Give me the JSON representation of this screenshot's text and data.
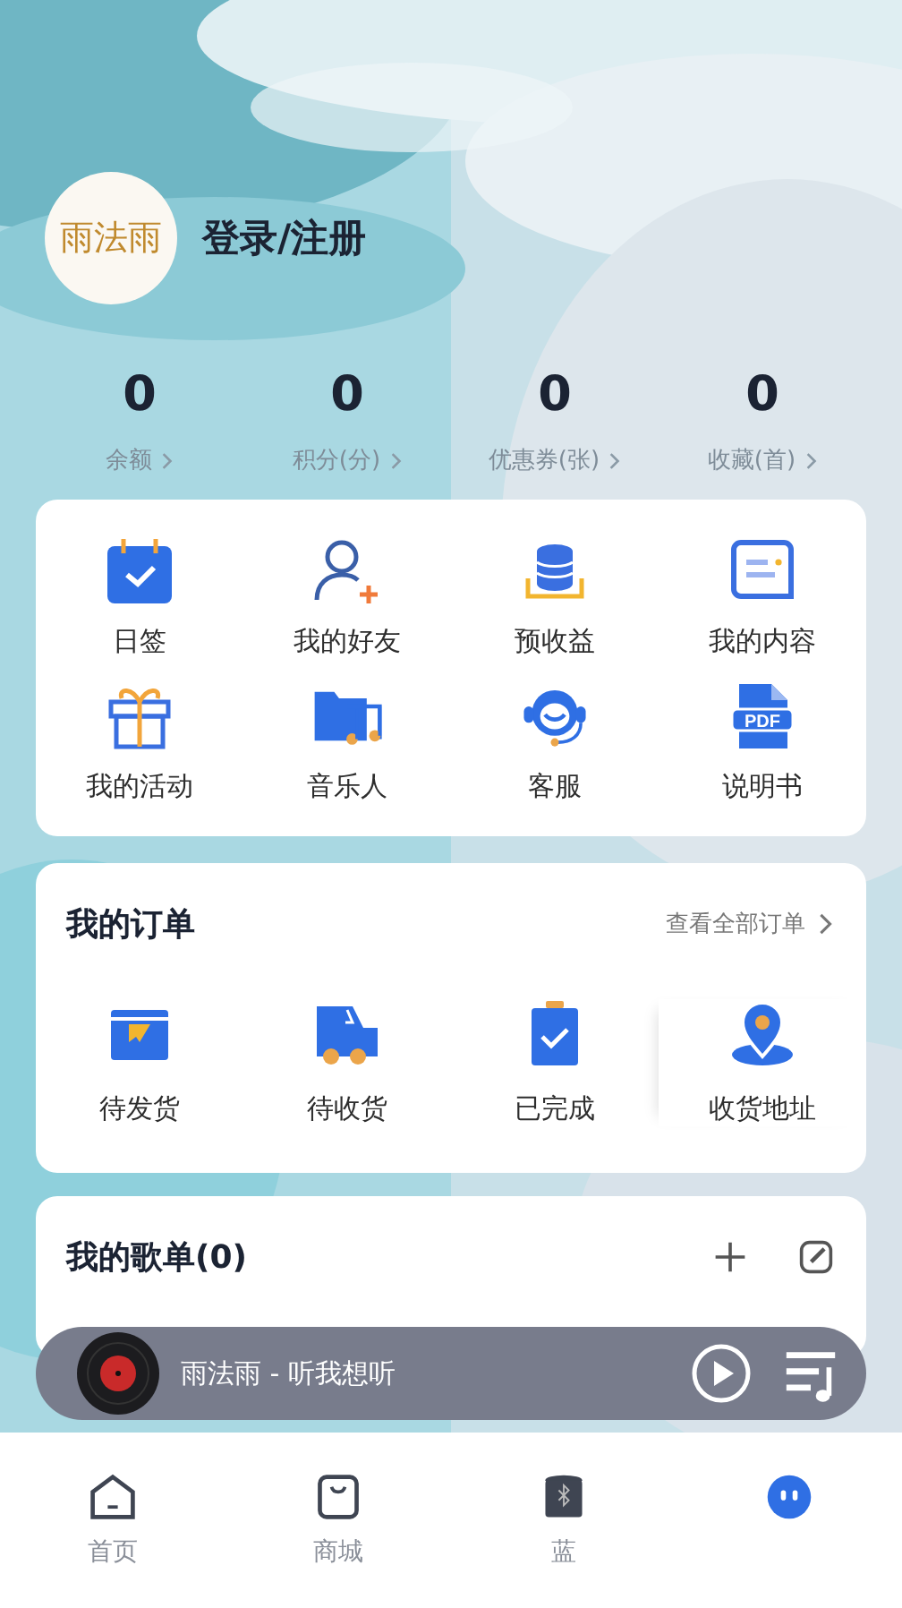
{
  "header": {
    "avatar_text": "雨法雨",
    "login": "登录/注册"
  },
  "stats": [
    {
      "value": "0",
      "label": "余额"
    },
    {
      "value": "0",
      "label": "积分(分)"
    },
    {
      "value": "0",
      "label": "优惠券(张)"
    },
    {
      "value": "0",
      "label": "收藏(首)"
    }
  ],
  "shortcuts": [
    {
      "label": "日签",
      "kind": "calendar"
    },
    {
      "label": "我的好友",
      "kind": "friend"
    },
    {
      "label": "预收益",
      "kind": "coins"
    },
    {
      "label": "我的内容",
      "kind": "content"
    },
    {
      "label": "我的活动",
      "kind": "gift"
    },
    {
      "label": "音乐人",
      "kind": "music"
    },
    {
      "label": "客服",
      "kind": "service"
    },
    {
      "label": "说明书",
      "kind": "pdf",
      "icon_text": "PDF"
    }
  ],
  "orders": {
    "title": "我的订单",
    "view_all": "查看全部订单",
    "items": [
      {
        "label": "待发货",
        "kind": "ship"
      },
      {
        "label": "待收货",
        "kind": "truck"
      },
      {
        "label": "已完成",
        "kind": "done"
      },
      {
        "label": "收货地址",
        "kind": "address"
      }
    ]
  },
  "playlists": {
    "title": "我的歌单(0)"
  },
  "player": {
    "track": "雨法雨 - 听我想听"
  },
  "tabs": [
    {
      "label": "首页",
      "kind": "home",
      "selected": false
    },
    {
      "label": "商城",
      "kind": "shop",
      "selected": false
    },
    {
      "label": "蓝",
      "kind": "speaker",
      "selected": false
    },
    {
      "kind": "mine",
      "selected": true
    }
  ]
}
